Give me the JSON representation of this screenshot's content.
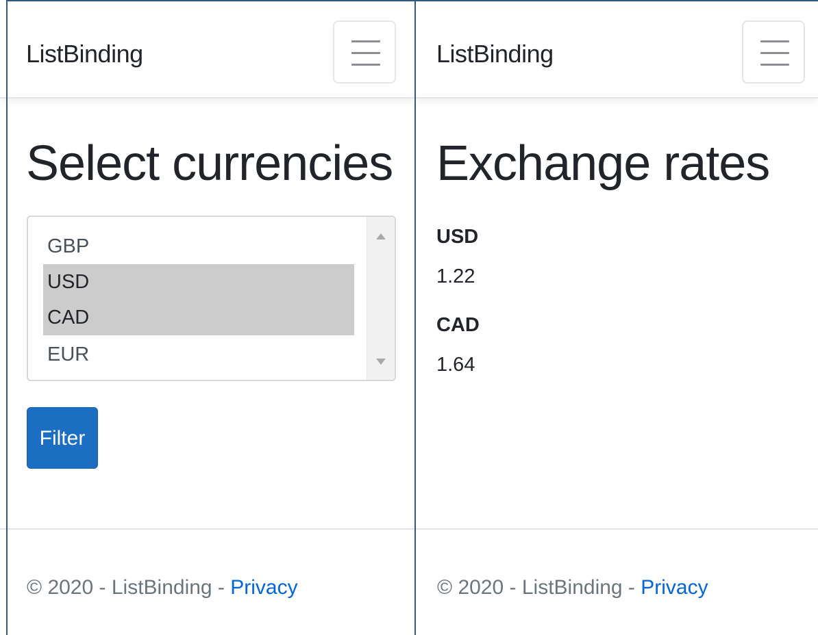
{
  "left_screen": {
    "brand": "ListBinding",
    "title": "Select currencies",
    "currencies": [
      {
        "code": "GBP",
        "selected": false
      },
      {
        "code": "USD",
        "selected": true
      },
      {
        "code": "CAD",
        "selected": true
      },
      {
        "code": "EUR",
        "selected": false
      }
    ],
    "filter_button": "Filter",
    "footer": {
      "copyright": "© 2020 - ListBinding - ",
      "privacy_link": "Privacy"
    }
  },
  "right_screen": {
    "brand": "ListBinding",
    "title": "Exchange rates",
    "rates": [
      {
        "code": "USD",
        "value": "1.22"
      },
      {
        "code": "CAD",
        "value": "1.64"
      }
    ],
    "footer": {
      "copyright": "© 2020 - ListBinding - ",
      "privacy_link": "Privacy"
    }
  },
  "colors": {
    "primary_button": "#1b6ec2",
    "link": "#0366d6",
    "selected_option": "#cccccc",
    "frame_border": "#2c5a85"
  },
  "icons": {
    "menu": "hamburger-menu-icon",
    "scroll_up": "scroll-up-arrow-icon",
    "scroll_down": "scroll-down-arrow-icon"
  }
}
